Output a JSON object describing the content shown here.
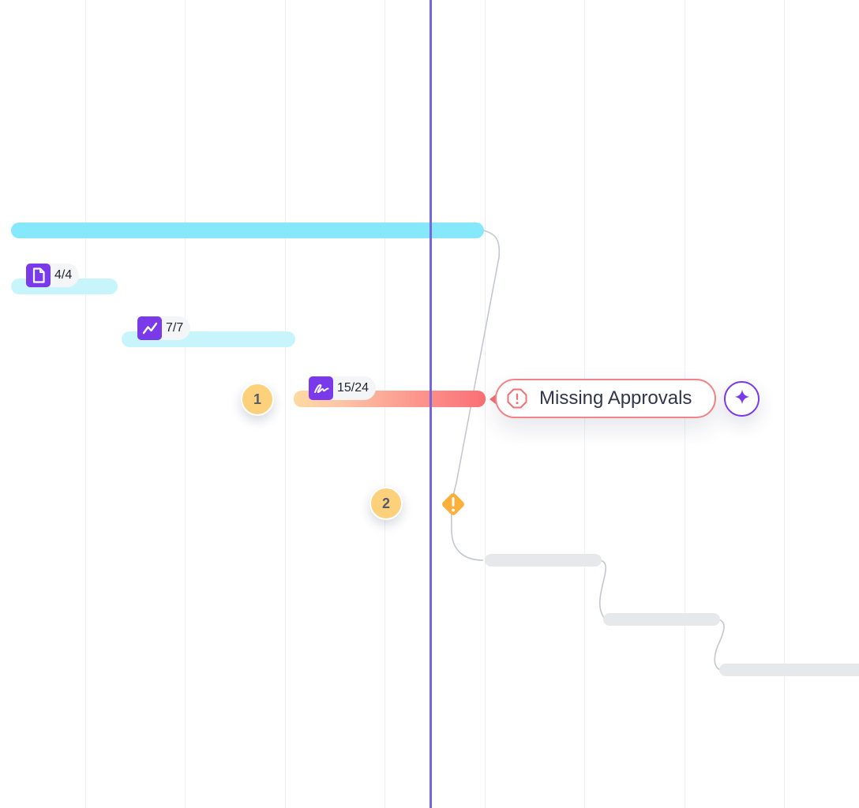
{
  "timeline": {
    "tasks": [
      {
        "id": "documents",
        "icon": "document-icon",
        "count": "4/4"
      },
      {
        "id": "analytics",
        "icon": "trend-chart-icon",
        "count": "7/7"
      },
      {
        "id": "signatures",
        "icon": "signature-icon",
        "count": "15/24"
      }
    ],
    "steps": [
      "1",
      "2"
    ],
    "alert": {
      "icon": "alert-octagon-icon",
      "text": "Missing Approvals"
    },
    "ai_action": {
      "icon": "sparkle-icon"
    },
    "milestone": {
      "icon": "warning-diamond-icon"
    }
  },
  "colors": {
    "accent": "#7b3aea",
    "today_line": "#7565e0",
    "primary_bar": "#86e9fb",
    "secondary_bar": "#c8f5fc",
    "alert": "#f26f74",
    "warning": "#fbb03b",
    "step_badge": "#fdd17c",
    "future_bar": "#e6e8ec"
  }
}
